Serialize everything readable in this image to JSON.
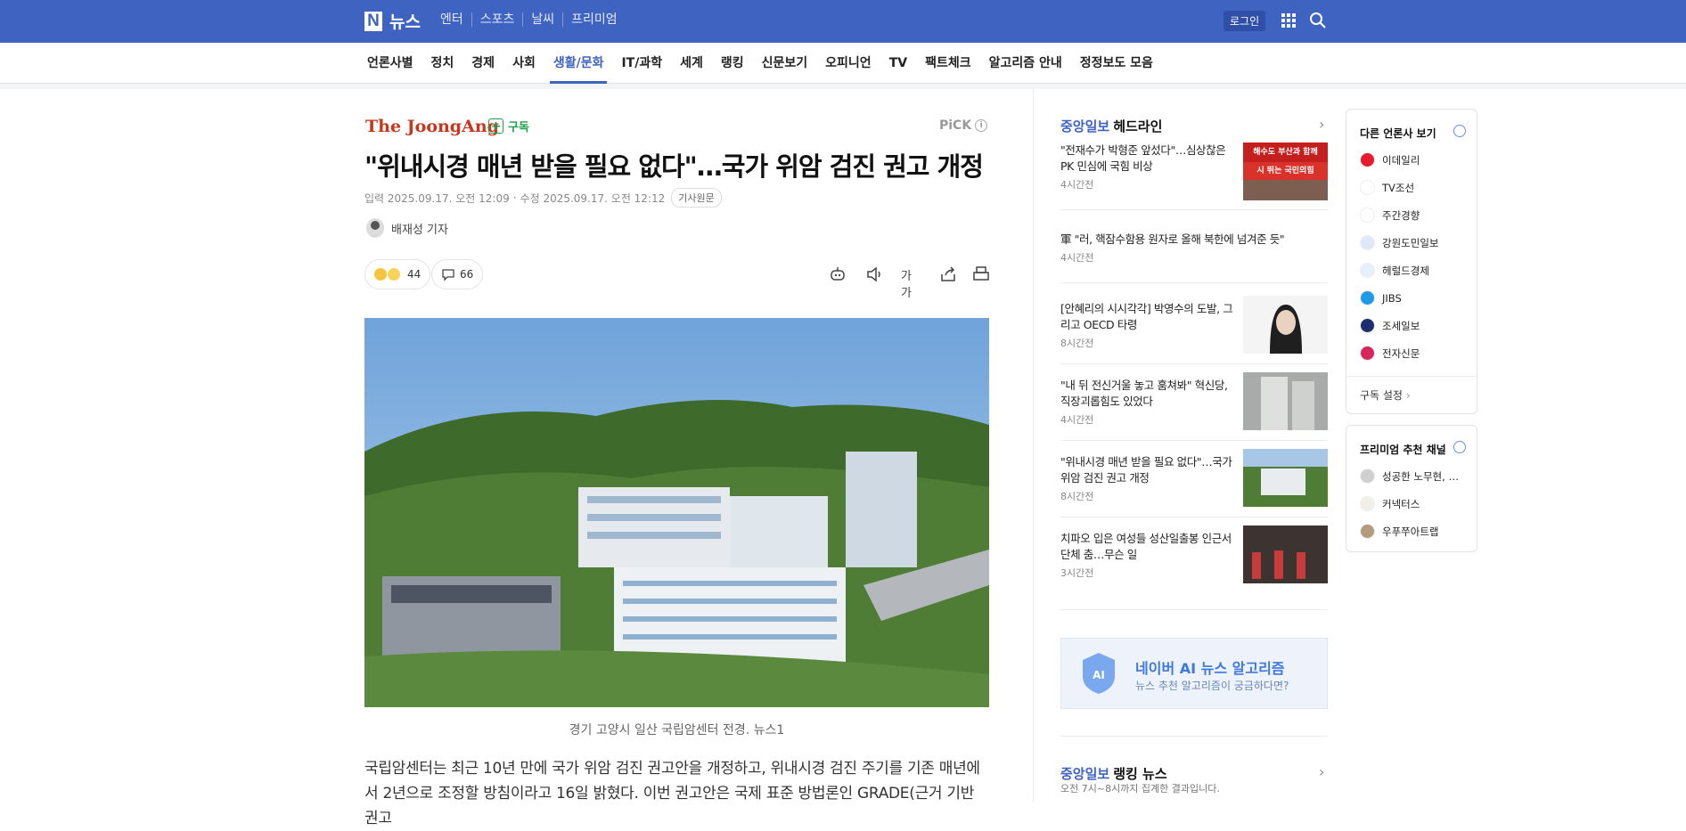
{
  "header": {
    "logo_letter": "N",
    "logo_text": "뉴스",
    "nav": [
      "엔터",
      "스포츠",
      "날씨",
      "프리미엄"
    ],
    "login": "로그인"
  },
  "subnav": {
    "items": [
      "언론사별",
      "정치",
      "경제",
      "사회",
      "생활/문화",
      "IT/과학",
      "세계",
      "랭킹",
      "신문보기",
      "오피니언",
      "TV",
      "팩트체크",
      "알고리즘 안내",
      "정정보도 모음"
    ],
    "active_index": 4
  },
  "article": {
    "press": "The JoongAng",
    "subscribe": "구독",
    "pick": "PiCK",
    "pick_info": "i",
    "headline": "\"위내시경 매년 받을 필요 없다\"…국가 위암 검진 권고 개정",
    "input_date": "입력 2025.09.17. 오전 12:09",
    "edit_date": "수정 2025.09.17. 오전 12:12",
    "original_badge": "기사원문",
    "reporter": "배재성 기자",
    "reactions": "44",
    "comments": "66",
    "text_size_label": "가가",
    "caption": "경기 고양시 일산 국립암센터 전경. 뉴스1",
    "body": "국립암센터는 최근 10년 만에 국가 위암 검진 권고안을 개정하고, 위내시경 검진 주기를 기존 매년에서 2년으로 조정할 방침이라고 16일 밝혔다. 이번 권고안은 국제 표준 방법론인 GRADE(근거 기반 권고"
  },
  "headlines": {
    "press": "중앙일보",
    "title": "헤드라인",
    "items": [
      {
        "title": "\"전재수가 박형준 앞섰다\"…심상찮은 PK 민심에 국힘 비상",
        "time": "4시간전",
        "thumb_text_1": "해수도 부산과 함께",
        "thumb_text_2": "시 뛰는 국민의힘"
      },
      {
        "title": "軍 \"러, 핵잠수함용 원자로 올해 북한에 넘겨준 듯\"",
        "time": "4시간전"
      },
      {
        "title": "[안혜리의 시시각각] 박영수의 도발, 그리고 OECD 타령",
        "time": "8시간전"
      },
      {
        "title": "\"내 뒤 전신거울 놓고 훔쳐봐\" 혁신당, 직장괴롭힘도 있었다",
        "time": "4시간전"
      },
      {
        "title": "\"위내시경 매년 받을 필요 없다\"…국가 위암 검진 권고 개정",
        "time": "8시간전"
      },
      {
        "title": "치파오 입은 여성들 성산일출봉 인근서 단체 춤…무슨 일",
        "time": "3시간전"
      }
    ]
  },
  "ai_box": {
    "icon_text": "AI",
    "title": "네이버 AI 뉴스 알고리즘",
    "subtitle": "뉴스 추천 알고리즘이 궁금하다면?"
  },
  "ranking": {
    "press": "중앙일보",
    "title": "랭킹 뉴스",
    "subtitle": "오전 7시~8시까지 집계한 결과입니다."
  },
  "other_press": {
    "title": "다른 언론사 보기",
    "items": [
      {
        "name": "이데일리",
        "color": "#e8192c"
      },
      {
        "name": "TV조선",
        "color": "#ffffff"
      },
      {
        "name": "주간경향",
        "color": "#ffffff"
      },
      {
        "name": "강원도민일보",
        "color": "#dfe8f6"
      },
      {
        "name": "헤럴드경제",
        "color": "#e4f0fb"
      },
      {
        "name": "JIBS",
        "color": "#1e9be8"
      },
      {
        "name": "조세일보",
        "color": "#1c2e6e"
      },
      {
        "name": "전자신문",
        "color": "#d6265b"
      }
    ],
    "footer": "구독 설정"
  },
  "premium": {
    "title": "프리미엄 추천 채널",
    "items": [
      "성공한 노무현, …",
      "커넥터스",
      "우푸쭈아트랩"
    ]
  },
  "colors": {
    "brand": "#3f63c1",
    "press_red": "#c8361d",
    "subscribe_green": "#1fa04a"
  }
}
